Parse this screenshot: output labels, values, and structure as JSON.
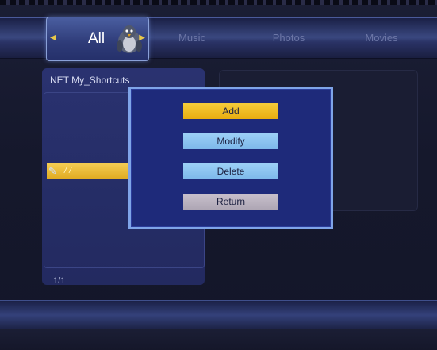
{
  "tabs": {
    "all": "All",
    "music": "Music",
    "photos": "Photos",
    "movies": "Movies"
  },
  "browser": {
    "path": "NET  My_Shortcuts",
    "selected_item": "/  /",
    "page": "1/1"
  },
  "dialog": {
    "add": "Add",
    "modify": "Modify",
    "delete": "Delete",
    "return": "Return"
  },
  "icons": {
    "selected_item_icon": "network-icon",
    "all_tab_icon": "penguin-icon"
  },
  "colors": {
    "highlight_yellow": "#f0c030",
    "button_blue": "#8cc4f0",
    "button_gray": "#bab2c0",
    "dialog_bg": "#1e2a7a"
  }
}
